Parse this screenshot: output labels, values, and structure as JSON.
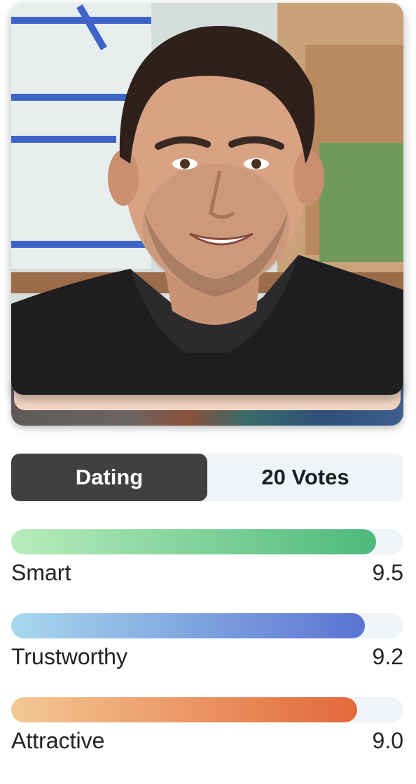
{
  "profile": {
    "photo_alt": "profile-photo"
  },
  "tabs": {
    "active_label": "Dating",
    "votes_label": "20 Votes"
  },
  "metrics": [
    {
      "label": "Smart",
      "value": "9.5",
      "score": 9.5,
      "color_start": "#b8ecbd",
      "color_end": "#4db97b"
    },
    {
      "label": "Trustworthy",
      "value": "9.2",
      "score": 9.2,
      "color_start": "#a9d8ee",
      "color_end": "#5a73d2"
    },
    {
      "label": "Attractive",
      "value": "9.0",
      "score": 9.0,
      "color_start": "#f3c893",
      "color_end": "#e3683a"
    }
  ]
}
